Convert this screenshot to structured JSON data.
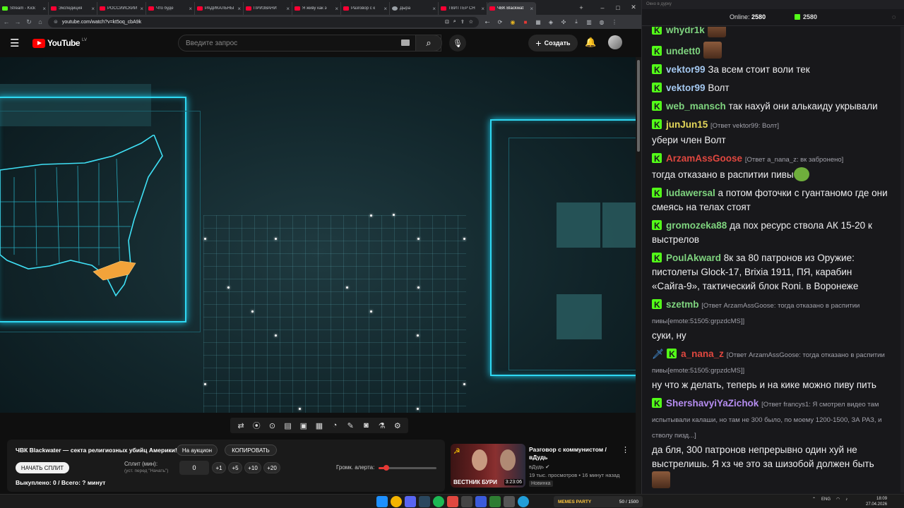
{
  "browser": {
    "tabs": [
      {
        "label": "Stream - Kick",
        "icon": "kick",
        "active": false
      },
      {
        "label": "Экспедиция",
        "icon": "youtube",
        "active": false
      },
      {
        "label": "РОССИЙСКИЙ",
        "icon": "youtube",
        "active": false
      },
      {
        "label": "Что буде",
        "icon": "youtube",
        "active": false
      },
      {
        "label": "РАДИКАЛЬНЫ",
        "icon": "youtube",
        "active": false
      },
      {
        "label": "ПРИЗВАНИ",
        "icon": "youtube",
        "active": false
      },
      {
        "label": "Я живу как э",
        "icon": "youtube",
        "active": false
      },
      {
        "label": "Разговор с к",
        "icon": "youtube",
        "active": false
      },
      {
        "label": "Дыра",
        "icon": "globe",
        "active": false
      },
      {
        "label": "ТВИТТЕР СН",
        "icon": "youtube",
        "active": false
      },
      {
        "label": "ЧВК Blackwat",
        "icon": "youtube",
        "active": true
      }
    ],
    "url": "youtube.com/watch?v=kt5oq_cbA9k",
    "new_tab": "+",
    "window_controls": [
      "–",
      "□",
      "✕"
    ]
  },
  "youtube": {
    "logo_text": "YouTube",
    "region": "LV",
    "search_placeholder": "Введите запрос",
    "create_label": "Создать"
  },
  "panel": {
    "title": "ЧВК Blackwater — секта религиозных убийц Америки!",
    "auction_label": "На аукцион",
    "copy_label": "КОПИРОВАТЬ",
    "start_label": "НАЧАТЬ СПЛИТ",
    "split_label": "Сплит (мин):",
    "split_hint": "(уст. перед \"Начать\")",
    "split_value": "0",
    "increments": [
      "+1",
      "+5",
      "+10",
      "+20"
    ],
    "alert_label": "Громк. алерта:",
    "alert_level": 0.14,
    "bought_text": "Выкуплено: 0 / Всего: ? минут"
  },
  "recommended": {
    "thumb_text": "ВЕСТНИК БУРИ",
    "duration": "3:23:06",
    "title": "Разговор с коммунистом / вДудь",
    "channel": "вДудь",
    "meta": "19 тыс. просмотров • 16 минут назад",
    "badge": "Новинка"
  },
  "chat": {
    "window_title": "Окно в дурку",
    "online_label": "Online:",
    "online_count": "2580",
    "kick_count": "2580",
    "messages": [
      {
        "user": "whydr1k",
        "color": "#7fd47f",
        "reply": "",
        "text": "",
        "emote": "face"
      },
      {
        "user": "undett0",
        "color": "#7fd47f",
        "reply": "",
        "text": "",
        "emote": "face"
      },
      {
        "user": "vektor99",
        "color": "#a4c8f0",
        "reply": "",
        "text": "За всем стоит воли тек",
        "emote": ""
      },
      {
        "user": "vektor99",
        "color": "#a4c8f0",
        "reply": "",
        "text": "Волт",
        "emote": ""
      },
      {
        "user": "web_mansch",
        "color": "#7fd47f",
        "reply": "",
        "text": "так нахуй они алькаиду укрывали",
        "emote": ""
      },
      {
        "user": "junJun15",
        "color": "#e6d85a",
        "reply": "[Ответ vektor99: Волт]",
        "text": "убери член Волт",
        "emote": ""
      },
      {
        "user": "ArzamAssGoose",
        "color": "#e0473f",
        "reply": "[Ответ a_nana_z: вк забронено]",
        "text": "тогда отказано в распитии пивы",
        "emote": "pepe"
      },
      {
        "user": "ludawersal",
        "color": "#7fd47f",
        "reply": "",
        "text": "а потом фоточки с гуантаномо где они смеясь на телах стоят",
        "emote": ""
      },
      {
        "user": "gromozeka88",
        "color": "#7fd47f",
        "reply": "",
        "text": "да пох ресурс ствола АК 15-20 к выстрелов",
        "emote": ""
      },
      {
        "user": "PoulAkward",
        "color": "#7fd47f",
        "reply": "",
        "text": "8к за 80 патронов из Оружие: пистолеты Glock-17, Brixia 1911, ПЯ, карабин «Сайга-9», тактический блок Roni. в Воронеже",
        "emote": ""
      },
      {
        "user": "szetmb",
        "color": "#7fd47f",
        "reply": "[Ответ ArzamAssGoose: тогда отказано в распитии пивы[emote:51505:grpzdcMS]]",
        "text": "суки, ну",
        "emote": ""
      },
      {
        "user": "a_nana_z",
        "color": "#e0473f",
        "reply": "[Ответ ArzamAssGoose: тогда отказано в распитии пивы[emote:51505:grpzdcMS]]",
        "text": "ну что ж делать, теперь и на кике можно пиву пить",
        "emote": "",
        "badge_sword": true
      },
      {
        "user": "ShershavyiYaZichok",
        "color": "#b58cf0",
        "reply": "[Ответ francys1: Я смотрел видео там испытывали калаши, но там не 300 было, по моему 1200-1500, ЗА РАЗ, и стволу пизд...]",
        "text": "да бля, 300 патронов непрерывно один хуй не выстрелишь. Я хз че это за шизобой должен быть",
        "emote": "face"
      }
    ]
  },
  "taskbar": {
    "memes_label": "MEMES PARTY",
    "memes_count": "50 / 1500",
    "lang": "ENG",
    "time": "18:09",
    "date": "27.04.2026"
  }
}
